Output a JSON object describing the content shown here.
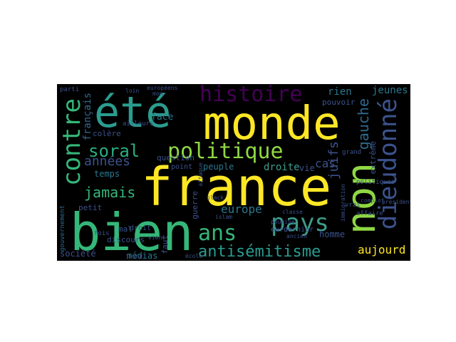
{
  "wordcloud": {
    "words": [
      {
        "text": "france",
        "color": "#fde725"
      },
      {
        "text": "bien",
        "color": "#35b779"
      },
      {
        "text": "monde",
        "color": "#fde725"
      },
      {
        "text": "été",
        "color": "#2a9d8f"
      },
      {
        "text": "non",
        "color": "#8fd744"
      },
      {
        "text": "dieudonné",
        "color": "#3b528b"
      },
      {
        "text": "politique",
        "color": "#8fd744"
      },
      {
        "text": "histoire",
        "color": "#440154"
      },
      {
        "text": "contre",
        "color": "#35b779"
      },
      {
        "text": "pays",
        "color": "#3e9b8a"
      },
      {
        "text": "ans",
        "color": "#35b779"
      },
      {
        "text": "antisémitisme",
        "color": "#2a9d8f"
      },
      {
        "text": "soral",
        "color": "#29af7f"
      },
      {
        "text": "gauche",
        "color": "#31688e"
      },
      {
        "text": "années",
        "color": "#3b528b"
      },
      {
        "text": "jamais",
        "color": "#35b779"
      },
      {
        "text": "juifs",
        "color": "#3b528b"
      },
      {
        "text": "europe",
        "color": "#2a788e"
      },
      {
        "text": "droite",
        "color": "#3e9b8a"
      },
      {
        "text": "aujourd",
        "color": "#fde725"
      },
      {
        "text": "français",
        "color": "#31688e"
      },
      {
        "text": "rien",
        "color": "#2a788e"
      },
      {
        "text": "jeunes",
        "color": "#2a788e"
      },
      {
        "text": "société",
        "color": "#3b528b"
      },
      {
        "text": "médias",
        "color": "#2a788e"
      },
      {
        "text": "temps",
        "color": "#2a788e"
      },
      {
        "text": "face",
        "color": "#2a788e"
      },
      {
        "text": "peuple",
        "color": "#2a788e"
      },
      {
        "text": "homme",
        "color": "#3b528b"
      },
      {
        "text": "cas",
        "color": "#3b528b"
      },
      {
        "text": "vie",
        "color": "#3b528b"
      },
      {
        "text": "petit",
        "color": "#3b528b"
      },
      {
        "text": "discours",
        "color": "#3b528b"
      },
      {
        "text": "question",
        "color": "#3b528b"
      },
      {
        "text": "colère",
        "color": "#3b528b"
      },
      {
        "text": "guerre",
        "color": "#3b528b"
      },
      {
        "text": "pouvoir",
        "color": "#3b528b"
      },
      {
        "text": "faut",
        "color": "#3b528b"
      },
      {
        "text": "mal",
        "color": "#3b528b"
      },
      {
        "text": "point",
        "color": "#3b528b"
      },
      {
        "text": "extrême",
        "color": "#3b528b"
      },
      {
        "text": "droit",
        "color": "#3b528b"
      },
      {
        "text": "euros",
        "color": "#3b528b"
      },
      {
        "text": "dernier",
        "color": "#3b528b"
      },
      {
        "text": "ailleurs",
        "color": "#3b528b"
      },
      {
        "text": "affaire",
        "color": "#3b528b"
      },
      {
        "text": "politiques",
        "color": "#3b528b"
      },
      {
        "text": "grand",
        "color": "#3b528b"
      },
      {
        "text": "vrai",
        "color": "#3b528b"
      },
      {
        "text": "fois",
        "color": "#3b528b"
      },
      {
        "text": "gouvernement",
        "color": "#31688e"
      },
      {
        "text": "parti",
        "color": "#3b528b"
      },
      {
        "text": "européens",
        "color": "#3b528b"
      },
      {
        "text": "président",
        "color": "#3b528b"
      },
      {
        "text": "complot",
        "color": "#3b528b"
      },
      {
        "text": "islam",
        "color": "#3b528b"
      },
      {
        "text": "vient",
        "color": "#3b528b"
      },
      {
        "text": "ancien",
        "color": "#3b528b"
      },
      {
        "text": "immigration",
        "color": "#3b528b"
      },
      {
        "text": "loin",
        "color": "#3b528b"
      },
      {
        "text": "mon",
        "color": "#3b528b"
      },
      {
        "text": "jeune",
        "color": "#3b528b"
      },
      {
        "text": "classe",
        "color": "#3b528b"
      },
      {
        "text": "poutine",
        "color": "#3b528b"
      },
      {
        "text": "black",
        "color": "#3b528b"
      },
      {
        "text": "attaque",
        "color": "#3b528b"
      },
      {
        "text": "école",
        "color": "#3b528b"
      }
    ]
  }
}
